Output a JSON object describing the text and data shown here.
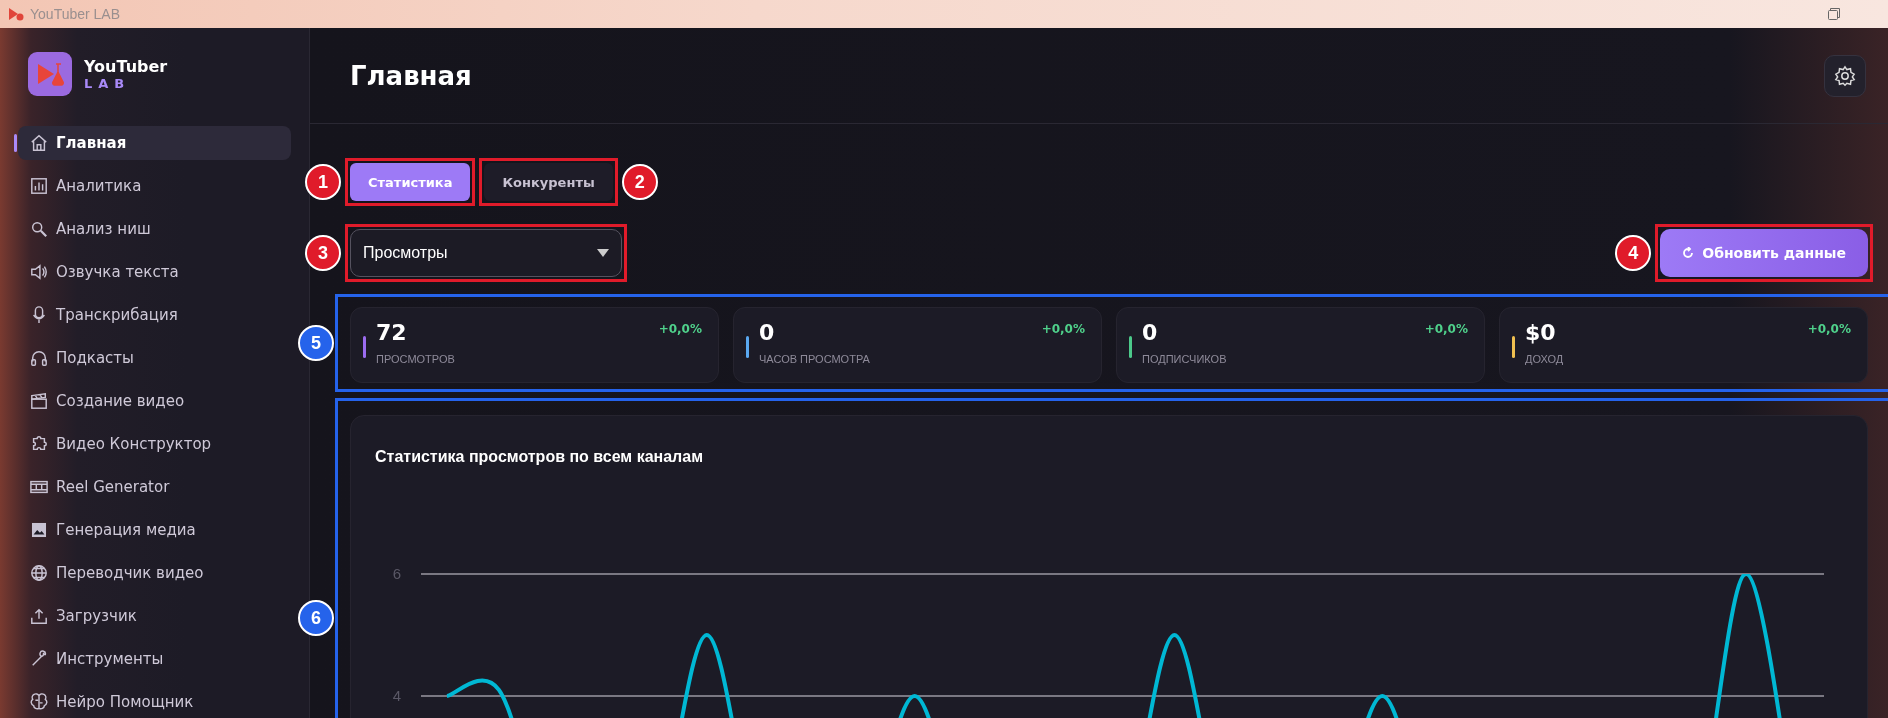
{
  "window": {
    "title": "YouTuber LAB"
  },
  "logo": {
    "name": "YouTuber",
    "sub": "LAB"
  },
  "sidebar": {
    "items": [
      {
        "label": "Главная",
        "selected": true
      },
      {
        "label": "Аналитика",
        "selected": false
      },
      {
        "label": "Анализ ниш",
        "selected": false
      },
      {
        "label": "Озвучка текста",
        "selected": false
      },
      {
        "label": "Транскрибация",
        "selected": false
      },
      {
        "label": "Подкасты",
        "selected": false
      },
      {
        "label": "Создание видео",
        "selected": false
      },
      {
        "label": "Видео Конструктор",
        "selected": false
      },
      {
        "label": "Reel Generator",
        "selected": false
      },
      {
        "label": "Генерация медиа",
        "selected": false
      },
      {
        "label": "Переводчик видео",
        "selected": false
      },
      {
        "label": "Загрузчик",
        "selected": false
      },
      {
        "label": "Инструменты",
        "selected": false
      },
      {
        "label": "Нейро Помощник",
        "selected": false
      }
    ]
  },
  "header": {
    "title": "Главная"
  },
  "tabs": [
    {
      "label": "Статистика",
      "selected": true,
      "callout": {
        "number": "1",
        "color": "#e01b2a"
      }
    },
    {
      "label": "Конкуренты",
      "selected": false,
      "callout": {
        "number": "2",
        "color": "#e01b2a"
      }
    }
  ],
  "metric_select": {
    "value": "Просмотры",
    "callout": {
      "number": "3",
      "color": "#e01b2a"
    }
  },
  "refresh_button": {
    "label": "Обновить данные",
    "callout": {
      "number": "4",
      "color": "#e01b2a"
    }
  },
  "stats": {
    "callout": {
      "number": "5",
      "color": "#2563eb"
    },
    "cards": [
      {
        "value": "72",
        "label": "ПРОСМОТРОВ",
        "change": "+0,0%",
        "color": "#9b6cf0"
      },
      {
        "value": "0",
        "label": "ЧАСОВ ПРОСМОТРА",
        "change": "+0,0%",
        "color": "#5aa8f0"
      },
      {
        "value": "0",
        "label": "ПОДПИСЧИКОВ",
        "change": "+0,0%",
        "color": "#4cc98a"
      },
      {
        "value": "$0",
        "label": "ДОХОД",
        "change": "+0,0%",
        "color": "#f0c050"
      }
    ]
  },
  "chart": {
    "callout": {
      "number": "6",
      "color": "#2563eb"
    },
    "chart_data": {
      "type": "line",
      "title": "Статистика просмотров по всем каналам",
      "ylim": [
        4,
        6
      ],
      "yticks": [
        4,
        6
      ],
      "series": [
        {
          "color": "#00b8d4",
          "values": [
            4,
            4.1,
            null,
            null,
            null,
            5,
            null,
            null,
            null,
            4,
            null,
            null,
            null,
            null,
            5,
            null,
            null,
            null,
            4,
            null,
            null,
            null,
            null,
            null,
            null,
            6,
            null
          ]
        }
      ]
    }
  }
}
